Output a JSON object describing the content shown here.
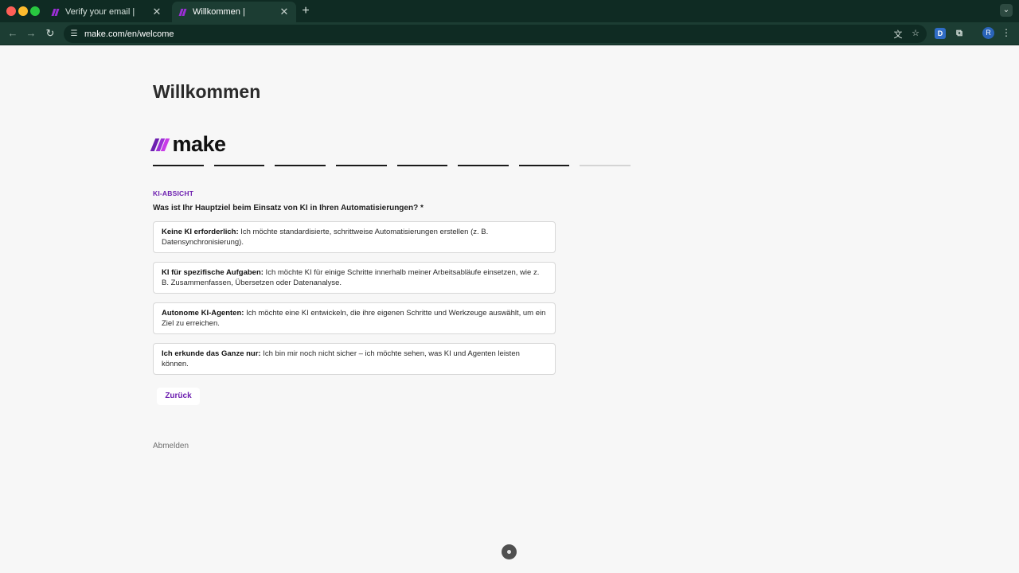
{
  "browser": {
    "tabs": [
      {
        "title": "Verify your email |"
      },
      {
        "title": "Willkommen |"
      }
    ],
    "new_tab_glyph": "+",
    "url": "make.com/en/welcome",
    "profile_initial": "R",
    "extension_initial": "D"
  },
  "page": {
    "title": "Willkommen",
    "logo_text": "make",
    "logo_colors": [
      "#6d1fb0",
      "#9b2fd6",
      "#c93be8"
    ],
    "progress": {
      "steps_total": 8,
      "steps_completed": 7
    },
    "section_label": "KI-ABSICHT",
    "question": "Was ist Ihr Hauptziel beim Einsatz von KI in Ihren Automatisierungen? *",
    "options": [
      {
        "title": "Keine KI erforderlich:",
        "text": " Ich möchte standardisierte, schrittweise Automatisierungen erstellen (z. B. Datensynchronisierung)."
      },
      {
        "title": "KI für spezifische Aufgaben:",
        "text": " Ich möchte KI für einige Schritte innerhalb meiner Arbeitsabläufe einsetzen, wie z. B. Zusammenfassen, Übersetzen oder Datenanalyse."
      },
      {
        "title": "Autonome KI-Agenten:",
        "text": " Ich möchte eine KI entwickeln, die ihre eigenen Schritte und Werkzeuge auswählt, um ein Ziel zu erreichen."
      },
      {
        "title": "Ich erkunde das Ganze nur:",
        "text": " Ich bin mir noch nicht sicher – ich möchte sehen, was KI und Agenten leisten können."
      }
    ],
    "back_label": "Zurück",
    "logout_label": "Abmelden"
  },
  "colors": {
    "accent": "#6d1fb0",
    "chrome": "#0f2b23"
  }
}
